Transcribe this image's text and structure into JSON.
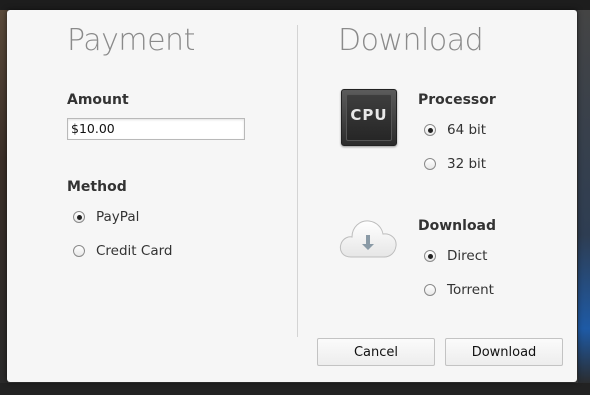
{
  "payment": {
    "heading": "Payment",
    "amount_label": "Amount",
    "amount_value": "$10.00",
    "method_label": "Method",
    "methods": [
      {
        "label": "PayPal",
        "checked": true
      },
      {
        "label": "Credit Card",
        "checked": false
      }
    ]
  },
  "download": {
    "heading": "Download",
    "processor_label": "Processor",
    "processor_icon": "cpu-icon",
    "processor_icon_text": "CPU",
    "processors": [
      {
        "label": "64 bit",
        "checked": true
      },
      {
        "label": "32 bit",
        "checked": false
      }
    ],
    "download_label": "Download",
    "download_icon": "cloud-download-icon",
    "modes": [
      {
        "label": "Direct",
        "checked": true
      },
      {
        "label": "Torrent",
        "checked": false
      }
    ]
  },
  "actions": {
    "cancel_label": "Cancel",
    "download_label": "Download"
  }
}
